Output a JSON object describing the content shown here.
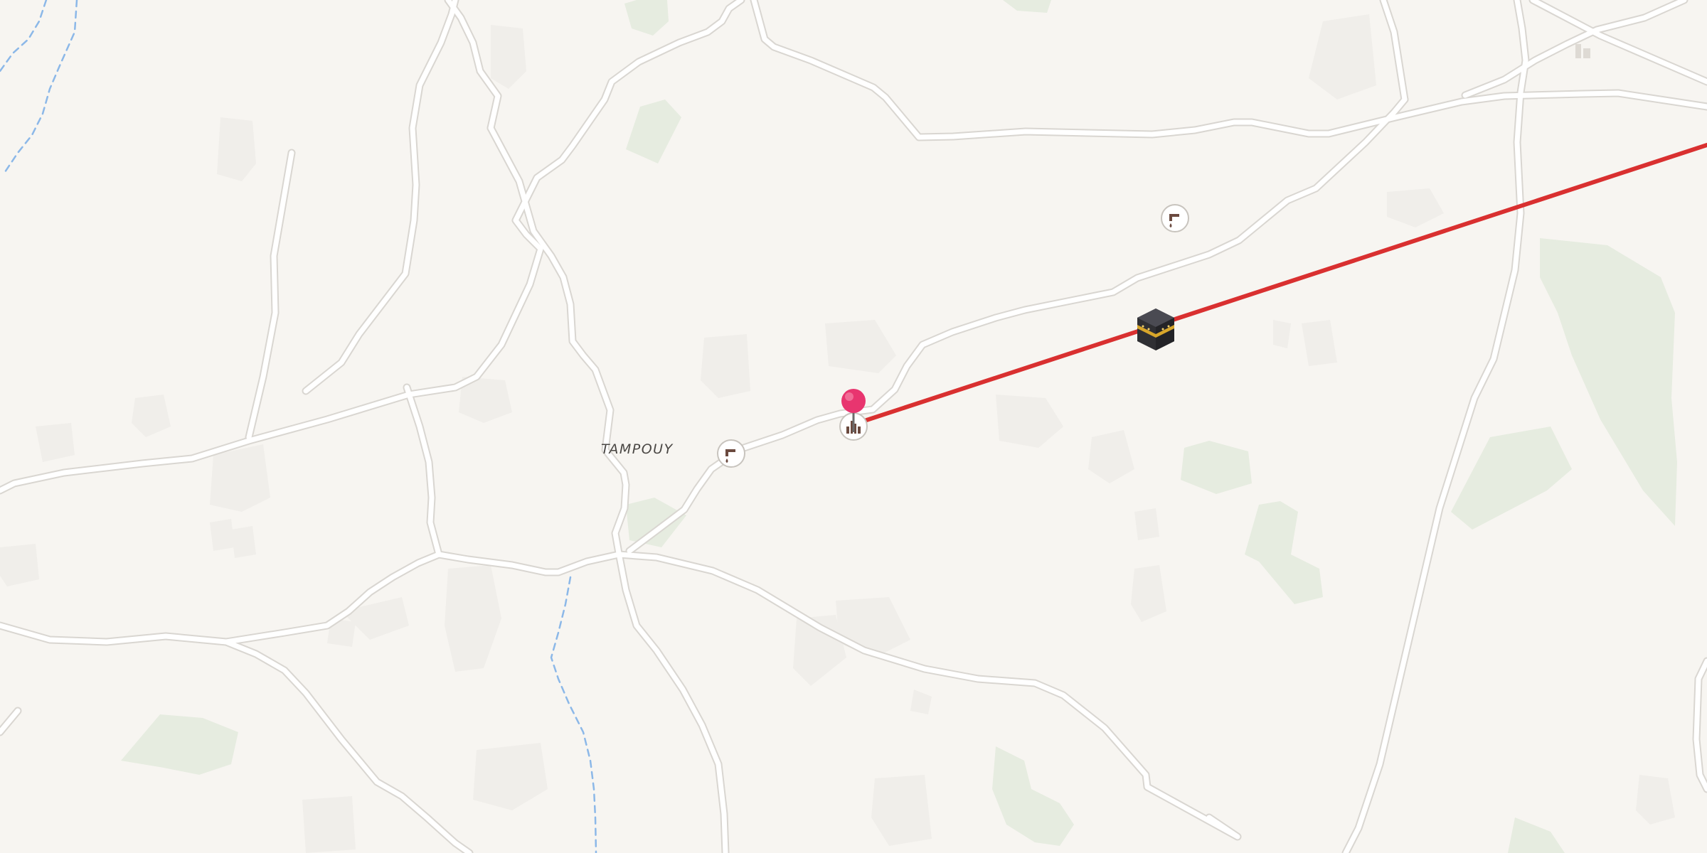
{
  "map": {
    "place_labels": [
      {
        "name": "TAMPOUY"
      }
    ],
    "markers": {
      "selected_pin": {
        "icon": "pin-icon",
        "color": "#e8356f"
      },
      "destination": {
        "icon": "kaaba-icon"
      },
      "qibla_line": {
        "color": "#d93030"
      }
    },
    "pois": [
      {
        "icon": "water-tap-icon"
      },
      {
        "icon": "water-tap-icon"
      },
      {
        "icon": "mosque-icon"
      }
    ],
    "colors": {
      "background": "#f7f5f1",
      "road": "#ffffff",
      "road_casing": "#d9d6d1",
      "vegetation": "#e6ece0",
      "water": "#8cb8e8"
    }
  }
}
